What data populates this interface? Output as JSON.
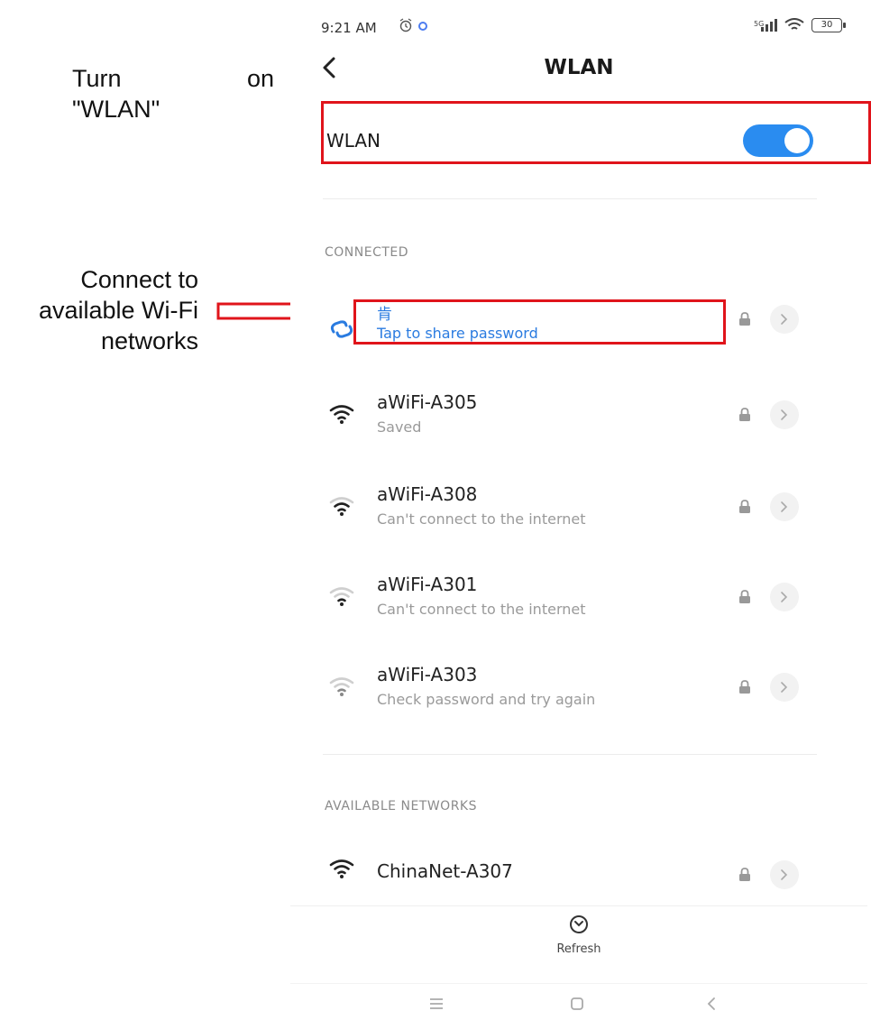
{
  "annotations": {
    "turn_on_words": [
      "Turn",
      "on"
    ],
    "turn_on_target": "\"WLAN\"",
    "connect_lines": [
      "Connect to",
      "available Wi-Fi",
      "networks"
    ]
  },
  "status_bar": {
    "time": "9:21 AM",
    "battery": "30"
  },
  "header": {
    "title": "WLAN"
  },
  "wlan_toggle": {
    "label": "WLAN",
    "state": "on",
    "accent_color": "#2a8cf0"
  },
  "sections": {
    "connected_label": "CONNECTED",
    "available_label": "AVAILABLE NETWORKS"
  },
  "connected_network": {
    "name": "肯",
    "status": "Tap to share password",
    "secured": true,
    "color": "#2a7be0"
  },
  "saved_networks": [
    {
      "name": "aWiFi-A305",
      "status": "Saved",
      "signal": "strong",
      "secured": true
    },
    {
      "name": "aWiFi-A308",
      "status": "Can't connect to the internet",
      "signal": "medium",
      "secured": true
    },
    {
      "name": "aWiFi-A301",
      "status": "Can't connect to the internet",
      "signal": "weak",
      "secured": true
    },
    {
      "name": "aWiFi-A303",
      "status": "Check password and try again",
      "signal": "weak",
      "secured": true
    }
  ],
  "available_networks": [
    {
      "name": "ChinaNet-A307",
      "signal": "strong",
      "secured": true
    }
  ],
  "footer": {
    "refresh_label": "Refresh"
  },
  "icons": {
    "back": "chevron-left-icon",
    "wifi": "wifi-icon",
    "lock": "lock-icon",
    "chevron": "chevron-right-icon",
    "refresh": "refresh-icon",
    "nav_menu": "menu-icon",
    "nav_home": "home-square-icon",
    "nav_back": "back-icon"
  },
  "highlight_color": "#e0141b"
}
